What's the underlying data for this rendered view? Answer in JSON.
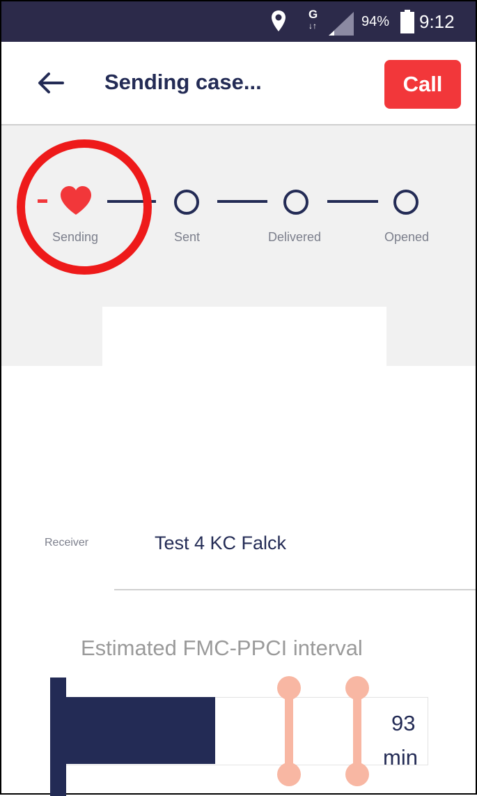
{
  "status_bar": {
    "network_type": "G",
    "battery": "94%",
    "time": "9:12",
    "icons": [
      "location-pin-icon",
      "signal-icon",
      "battery-icon"
    ]
  },
  "header": {
    "title": "Sending case...",
    "call_label": "Call",
    "back_icon": "back-arrow-icon"
  },
  "progress": {
    "steps": [
      {
        "label": "Sending",
        "state": "active",
        "icon": "heart-icon"
      },
      {
        "label": "Sent",
        "state": "pending",
        "icon": "circle-icon"
      },
      {
        "label": "Delivered",
        "state": "pending",
        "icon": "circle-icon"
      },
      {
        "label": "Opened",
        "state": "pending",
        "icon": "circle-icon"
      }
    ]
  },
  "receiver": {
    "label": "Receiver",
    "value": "Test 4 KC Falck"
  },
  "interval": {
    "title": "Estimated FMC-PPCI interval",
    "value": "93",
    "unit": "min"
  },
  "colors": {
    "navy": "#232b55",
    "accent_red": "#f2373a",
    "highlight": "#ee1a1a",
    "marker": "#f8b7a3",
    "status_bar": "#2c2a4a"
  }
}
